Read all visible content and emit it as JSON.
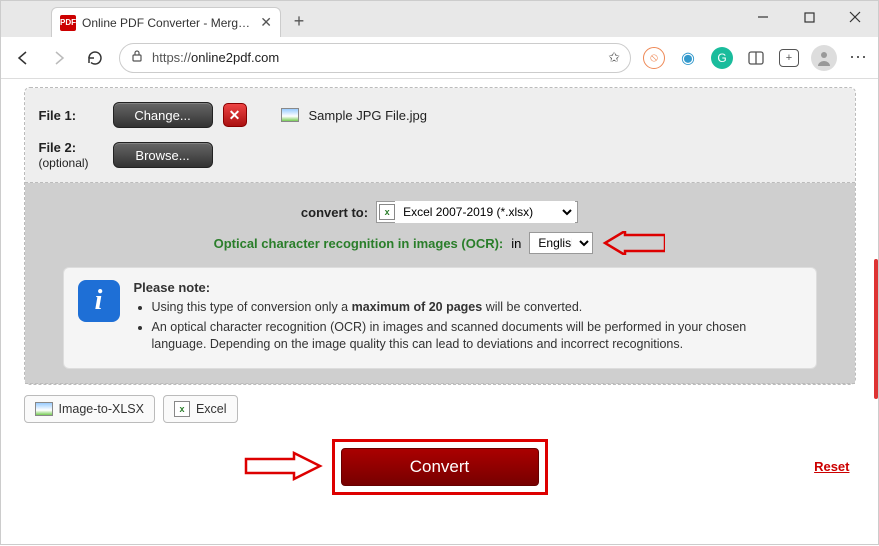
{
  "window": {
    "tab_title": "Online PDF Converter - Merge, c",
    "favicon_text": "PDF"
  },
  "toolbar": {
    "url_prefix": "https://",
    "url_domain": "online2pdf.com"
  },
  "files": {
    "file1_label": "File 1:",
    "file2_label": "File 2:",
    "file2_optional": "(optional)",
    "change_btn": "Change...",
    "browse_btn": "Browse...",
    "file1_name": "Sample JPG File.jpg"
  },
  "options": {
    "convert_to_label": "convert to:",
    "format_value": "Excel 2007-2019 (*.xlsx)",
    "ocr_label": "Optical character recognition in images (OCR):",
    "ocr_in": "in",
    "lang_value": "English"
  },
  "note": {
    "heading": "Please note:",
    "li1_pre": "Using this type of conversion only a ",
    "li1_bold": "maximum of 20 pages",
    "li1_post": " will be converted.",
    "li2": "An optical character recognition (OCR) in images and scanned documents will be performed in your chosen language. Depending on the image quality this can lead to deviations and incorrect recognitions."
  },
  "chips": {
    "image_to_xlsx": "Image-to-XLSX",
    "excel": "Excel"
  },
  "actions": {
    "convert": "Convert",
    "reset": "Reset"
  }
}
